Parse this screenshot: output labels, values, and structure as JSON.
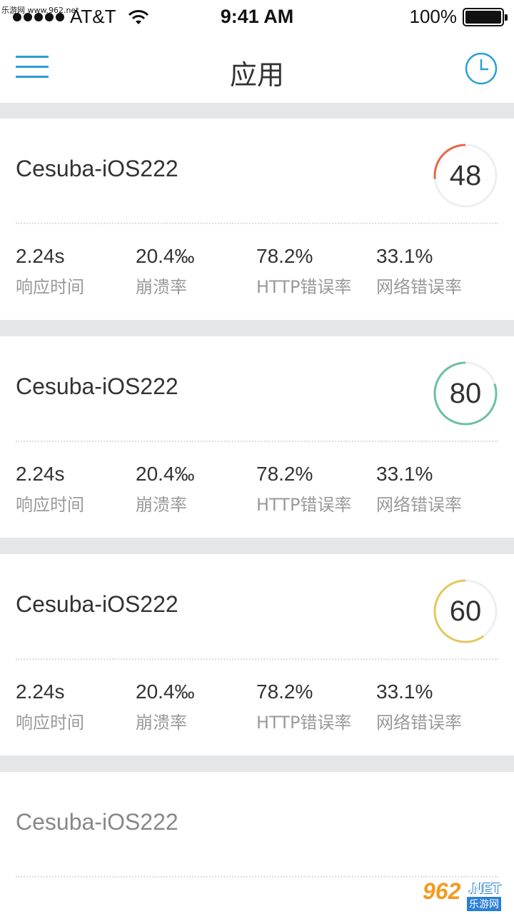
{
  "status_bar": {
    "watermark": "乐游网 www.962.net",
    "carrier": "AT&T",
    "time": "9:41 AM",
    "battery": "100%"
  },
  "nav": {
    "title": "应用",
    "menu_icon": "hamburger-menu-icon",
    "history_icon": "clock-icon",
    "accent_color": "#2a9fd6"
  },
  "apps": [
    {
      "name": "Cesuba-iOS222",
      "score": "48",
      "score_color": "#e8664a",
      "metrics": [
        {
          "value": "2.24s",
          "label": "响应时间"
        },
        {
          "value": "20.4‰",
          "label": "崩溃率"
        },
        {
          "value": "78.2%",
          "label": "HTTP错误率"
        },
        {
          "value": "33.1%",
          "label": "网络错误率"
        }
      ]
    },
    {
      "name": "Cesuba-iOS222",
      "score": "80",
      "score_color": "#6cc0a3",
      "metrics": [
        {
          "value": "2.24s",
          "label": "响应时间"
        },
        {
          "value": "20.4‰",
          "label": "崩溃率"
        },
        {
          "value": "78.2%",
          "label": "HTTP错误率"
        },
        {
          "value": "33.1%",
          "label": "网络错误率"
        }
      ]
    },
    {
      "name": "Cesuba-iOS222",
      "score": "60",
      "score_color": "#e3c95a",
      "metrics": [
        {
          "value": "2.24s",
          "label": "响应时间"
        },
        {
          "value": "20.4‰",
          "label": "崩溃率"
        },
        {
          "value": "78.2%",
          "label": "HTTP错误率"
        },
        {
          "value": "33.1%",
          "label": "网络错误率"
        }
      ]
    },
    {
      "name": "Cesuba-iOS222"
    }
  ],
  "watermark_bottom": {
    "num": "962",
    "net": ".NET",
    "sub": "乐游网"
  }
}
